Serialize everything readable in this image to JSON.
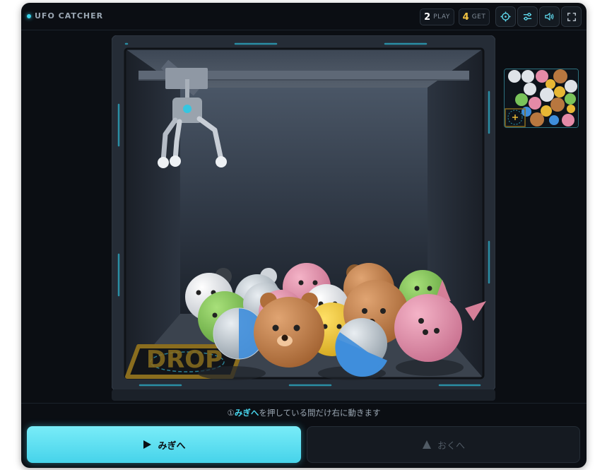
{
  "header": {
    "title": "UFO CATCHER",
    "play_count": "2",
    "play_label": "PLAY",
    "get_count": "4",
    "get_label": "GET"
  },
  "toolbar": {
    "icons": [
      "crosshair-icon",
      "settings-sliders-icon",
      "sound-icon",
      "fullscreen-icon"
    ]
  },
  "machine": {
    "drop_label": "DROP"
  },
  "instruction": {
    "step": "①",
    "highlight": "みぎへ",
    "text": "を押している間だけ右に動きます"
  },
  "controls": {
    "right_label": "みぎへ",
    "back_label": "おくへ"
  },
  "colors": {
    "accent": "#46d3ea",
    "play": "#ffffff",
    "get": "#f5c542",
    "background": "#0b0e13"
  }
}
